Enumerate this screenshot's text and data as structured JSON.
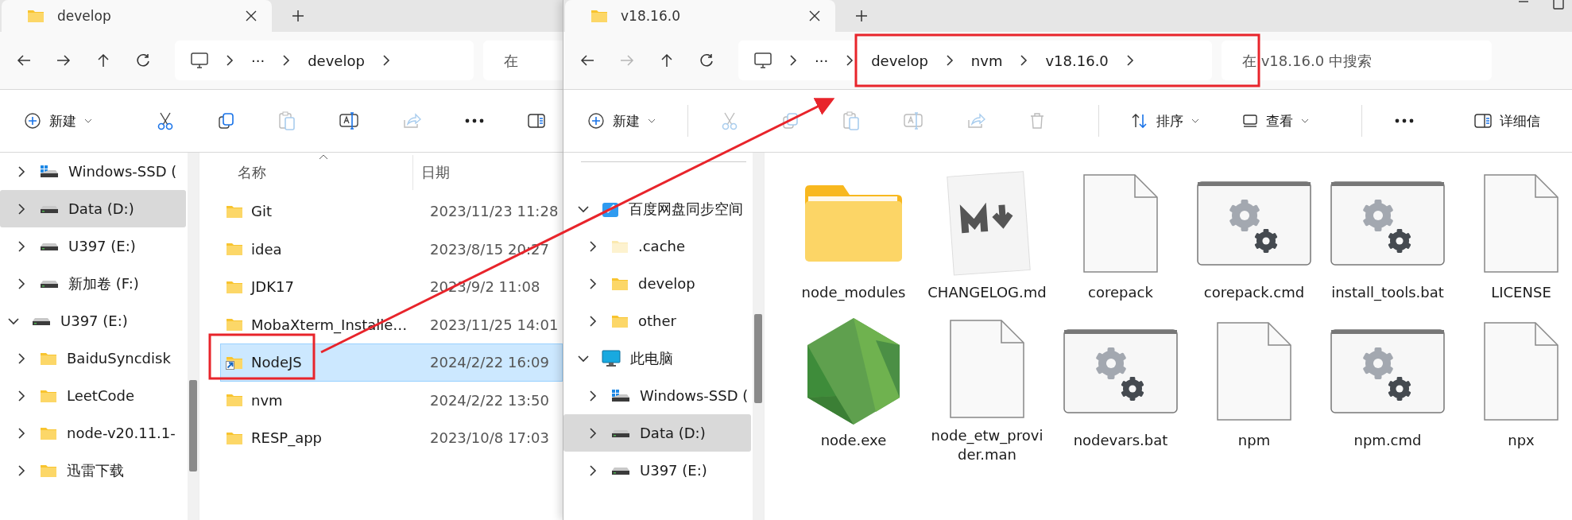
{
  "windows": [
    {
      "tab": {
        "title": "develop"
      },
      "nav": [
        {
          "kind": "back",
          "disabled": false
        },
        {
          "kind": "forward",
          "disabled": false
        },
        {
          "kind": "up",
          "disabled": false
        },
        {
          "kind": "refresh",
          "disabled": false
        }
      ],
      "breadcrumb": [
        "···",
        "develop"
      ],
      "search": {
        "placeholder": "在"
      },
      "toolbar": [
        {
          "kind": "new",
          "label": "新建",
          "disabled": false
        },
        {
          "kind": "cut",
          "disabled": false
        },
        {
          "kind": "copy",
          "disabled": false
        },
        {
          "kind": "paste",
          "disabled": true
        },
        {
          "kind": "rename",
          "disabled": false
        },
        {
          "kind": "share",
          "disabled": true
        },
        {
          "kind": "more"
        },
        {
          "kind": "details"
        }
      ],
      "sidebar": {
        "items": [
          {
            "kind": "windows-drive",
            "label": "Windows-SSD (",
            "selected": false,
            "expanded": false
          },
          {
            "kind": "drive",
            "label": "Data (D:)",
            "selected": true,
            "expanded": false
          },
          {
            "kind": "drive",
            "label": "U397 (E:)",
            "selected": false,
            "expanded": false
          },
          {
            "kind": "drive",
            "label": "新加卷 (F:)",
            "selected": false,
            "expanded": false
          },
          {
            "kind": "drive",
            "label": "U397 (E:)",
            "selected": false,
            "expanded": true,
            "children": [
              {
                "kind": "folder",
                "label": "BaiduSyncdisk",
                "selected": false,
                "expanded": false
              },
              {
                "kind": "folder",
                "label": "LeetCode",
                "selected": false,
                "expanded": false
              },
              {
                "kind": "folder",
                "label": "node-v20.11.1-",
                "selected": false,
                "expanded": false
              },
              {
                "kind": "folder",
                "label": "迅雷下载",
                "selected": false,
                "expanded": false
              }
            ]
          }
        ]
      },
      "view": {
        "kind": "details",
        "columns": [
          "名称",
          "日期"
        ],
        "rows": [
          {
            "shortcut": false,
            "name": "Git",
            "date": "2023/11/23 11:28",
            "selected": false
          },
          {
            "shortcut": false,
            "name": "idea",
            "date": "2023/8/15 20:27",
            "selected": false
          },
          {
            "shortcut": false,
            "name": "JDK17",
            "date": "2023/9/2 11:08",
            "selected": false
          },
          {
            "shortcut": false,
            "name": "MobaXterm_Installe…",
            "date": "2023/11/25 14:01",
            "selected": false
          },
          {
            "shortcut": true,
            "name": "NodeJS",
            "date": "2024/2/22 16:09",
            "selected": true
          },
          {
            "shortcut": false,
            "name": "nvm",
            "date": "2024/2/22 13:50",
            "selected": false
          },
          {
            "shortcut": false,
            "name": "RESP_app",
            "date": "2023/10/8 17:03",
            "selected": false
          }
        ]
      }
    },
    {
      "tab": {
        "title": "v18.16.0"
      },
      "nav": [
        {
          "kind": "back",
          "disabled": false
        },
        {
          "kind": "forward",
          "disabled": true
        },
        {
          "kind": "up",
          "disabled": false
        },
        {
          "kind": "refresh",
          "disabled": false
        }
      ],
      "breadcrumb": [
        "···",
        "develop",
        "nvm",
        "v18.16.0"
      ],
      "search": {
        "placeholder": "在 v18.16.0 中搜索"
      },
      "toolbar": [
        {
          "kind": "new",
          "label": "新建",
          "disabled": false
        },
        {
          "kind": "cut",
          "disabled": true
        },
        {
          "kind": "copy",
          "disabled": true
        },
        {
          "kind": "paste",
          "disabled": true
        },
        {
          "kind": "rename",
          "disabled": true
        },
        {
          "kind": "share",
          "disabled": true
        },
        {
          "kind": "delete",
          "disabled": true
        },
        {
          "kind": "sort",
          "label": "排序",
          "disabled": false
        },
        {
          "kind": "view",
          "label": "查看",
          "disabled": false
        },
        {
          "kind": "more"
        },
        {
          "kind": "details",
          "label": "详细信"
        }
      ],
      "sidebar": {
        "items": [
          {
            "kind": "separator"
          },
          {
            "kind": "cloud",
            "label": "百度网盘同步空间",
            "selected": false,
            "expanded": true,
            "children": [
              {
                "kind": "hidden-folder",
                "label": ".cache",
                "selected": false,
                "expanded": false
              },
              {
                "kind": "folder",
                "label": "develop",
                "selected": false,
                "expanded": false
              },
              {
                "kind": "folder",
                "label": "other",
                "selected": false,
                "expanded": false
              }
            ]
          },
          {
            "kind": "pc",
            "label": "此电脑",
            "selected": false,
            "expanded": true,
            "children": [
              {
                "kind": "windows-drive",
                "label": "Windows-SSD (",
                "selected": false,
                "expanded": false
              },
              {
                "kind": "drive",
                "label": "Data (D:)",
                "selected": true,
                "expanded": false
              },
              {
                "kind": "drive",
                "label": "U397 (E:)",
                "selected": false,
                "expanded": false
              }
            ]
          }
        ]
      },
      "view": {
        "kind": "icons",
        "items": [
          {
            "kind": "folder",
            "name": "node_modules"
          },
          {
            "kind": "markdown",
            "name": "CHANGELOG.md"
          },
          {
            "kind": "file",
            "name": "corepack"
          },
          {
            "kind": "script",
            "name": "corepack.cmd"
          },
          {
            "kind": "script",
            "name": "install_tools.bat"
          },
          {
            "kind": "file",
            "name": "LICENSE"
          },
          {
            "kind": "nodejs",
            "name": "node.exe"
          },
          {
            "kind": "file",
            "name": "node_etw_provider.man"
          },
          {
            "kind": "script",
            "name": "nodevars.bat"
          },
          {
            "kind": "file",
            "name": "npm"
          },
          {
            "kind": "script",
            "name": "npm.cmd"
          },
          {
            "kind": "file",
            "name": "npx"
          }
        ]
      }
    }
  ]
}
